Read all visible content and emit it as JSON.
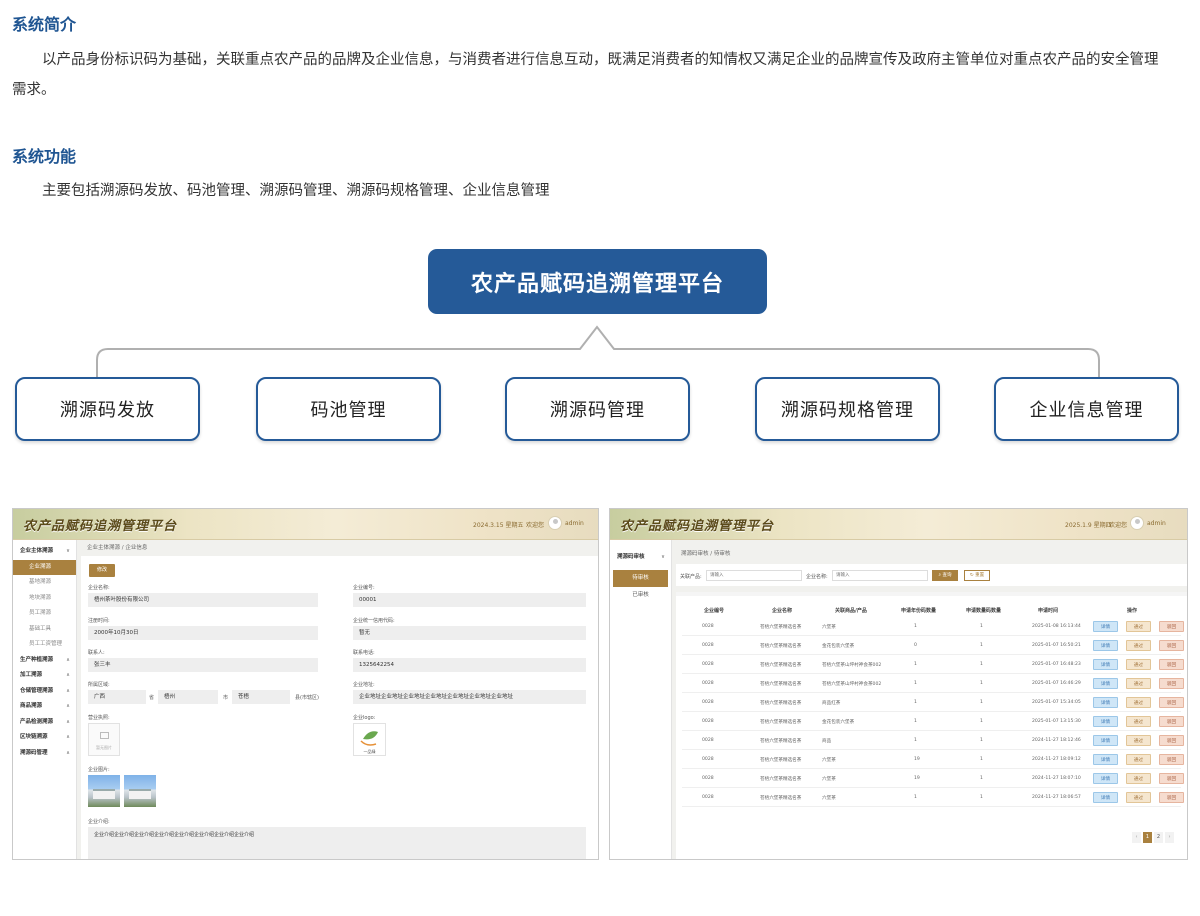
{
  "intro": {
    "title": "系统简介",
    "text": "以产品身份标识码为基础，关联重点农产品的品牌及企业信息，与消费者进行信息互动，既满足消费者的知情权又满足企业的品牌宣传及政府主管单位对重点农产品的安全管理需求。"
  },
  "functions_section": {
    "title": "系统功能",
    "text": "主要包括溯源码发放、码池管理、溯源码管理、溯源码规格管理、企业信息管理"
  },
  "diagram": {
    "platform": "农产品赋码追溯管理平台",
    "modules": [
      "溯源码发放",
      "码池管理",
      "溯源码管理",
      "溯源码规格管理",
      "企业信息管理"
    ],
    "colors": {
      "primary": "#255a98",
      "accent": "#a9813f"
    }
  },
  "screenshot_left": {
    "app_title": "农产品赋码追溯管理平台",
    "date": "2024.3.15 星期五",
    "welcome": "欢迎您",
    "user": "admin",
    "sidebar": [
      {
        "label": "企业主体溯源",
        "type": "group"
      },
      {
        "label": "企业溯源",
        "type": "sub-active"
      },
      {
        "label": "基地溯源",
        "type": "sub"
      },
      {
        "label": "地块溯源",
        "type": "sub"
      },
      {
        "label": "员工溯源",
        "type": "sub"
      },
      {
        "label": "基础工具",
        "type": "sub"
      },
      {
        "label": "员工工资管理",
        "type": "sub"
      },
      {
        "label": "生产种植溯源",
        "type": "group"
      },
      {
        "label": "加工溯源",
        "type": "group"
      },
      {
        "label": "仓储管理溯源",
        "type": "group"
      },
      {
        "label": "商品溯源",
        "type": "group"
      },
      {
        "label": "产品检测溯源",
        "type": "group"
      },
      {
        "label": "区块链溯源",
        "type": "group"
      },
      {
        "label": "溯源码管理",
        "type": "group"
      }
    ],
    "breadcrumb": "企业主体溯源 / 企业信息",
    "edit_label": "修改",
    "fields": {
      "company_name_label": "企业名称:",
      "company_name": "梧州茶叶股份有限公司",
      "company_code_label": "企业编号:",
      "company_code": "00001",
      "reg_time_label": "注册时间:",
      "reg_time": "2000年10月30日",
      "credit_code_label": "企业统一信用代码:",
      "credit_code": "暂无",
      "contact_label": "联系人:",
      "contact": "张三丰",
      "phone_label": "联系电话:",
      "phone": "1325642254",
      "region_label": "所属区域:",
      "province": "广西",
      "province_unit": "省",
      "city": "梧州",
      "city_unit": "市",
      "district": "苍梧",
      "district_unit": "县(市辖区)",
      "address_label": "企业地址:",
      "address": "企业地址企业地址企业地址企业地址企业地址企业地址企业地址",
      "license_label": "营业执照:",
      "license_placeholder": "暂无图片",
      "logo_label": "企业logo:",
      "logo_text": "一品绿",
      "photos_label": "企业图片:",
      "intro_label": "企业介绍:",
      "intro": "企业介绍企业介绍企业介绍企业介绍企业介绍企业介绍企业介绍企业介绍"
    }
  },
  "screenshot_right": {
    "app_title": "农产品赋码追溯管理平台",
    "date": "2025.1.9 星期四",
    "welcome": "欢迎您",
    "user": "admin",
    "sidebar_group": "溯源码审核",
    "sidebar_items": [
      "待审核",
      "已审核"
    ],
    "breadcrumb": "溯源码审核 / 待审核",
    "filter": {
      "product_label": "关联产品:",
      "product_placeholder": "请输入",
      "company_label": "企业名称:",
      "company_placeholder": "请输入",
      "query": "查询",
      "reset": "重置"
    },
    "columns": [
      "企业编号",
      "企业名称",
      "关联商品/产品",
      "申请年份码数量",
      "申请数量码数量",
      "申请时间",
      "操作"
    ],
    "ops": [
      "详情",
      "通过",
      "驳回"
    ],
    "rows": [
      [
        "0028",
        "苍梧六堡茶精选名茶",
        "六堡茶",
        "1",
        "1",
        "2025-01-08 16:13:44"
      ],
      [
        "0028",
        "苍梧六堡茶精选名茶",
        "金花包装六堡茶",
        "0",
        "1",
        "2025-01-07 16:50:21"
      ],
      [
        "0028",
        "苍梧六堡茶精选名茶",
        "苍梧六堡茶山坪村神会茶002",
        "1",
        "1",
        "2025-01-07 16:48:23"
      ],
      [
        "0028",
        "苍梧六堡茶精选名茶",
        "苍梧六堡茶山坪村神会茶002",
        "1",
        "1",
        "2025-01-07 16:46:29"
      ],
      [
        "0028",
        "苍梧六堡茶精选名茶",
        "商品红茶",
        "1",
        "1",
        "2025-01-07 15:34:05"
      ],
      [
        "0028",
        "苍梧六堡茶精选名茶",
        "金花包装六堡茶",
        "1",
        "1",
        "2025-01-07 13:15:30"
      ],
      [
        "0028",
        "苍梧六堡茶精选名茶",
        "商品",
        "1",
        "1",
        "2024-11-27 18:12:46"
      ],
      [
        "0028",
        "苍梧六堡茶精选名茶",
        "六堡茶",
        "19",
        "1",
        "2024-11-27 18:09:12"
      ],
      [
        "0028",
        "苍梧六堡茶精选名茶",
        "六堡茶",
        "19",
        "1",
        "2024-11-27 18:07:10"
      ],
      [
        "0028",
        "苍梧六堡茶精选名茶",
        "六堡茶",
        "1",
        "1",
        "2024-11-27 18:06:57"
      ]
    ],
    "pagination": [
      "‹",
      "1",
      "2",
      "›"
    ]
  }
}
